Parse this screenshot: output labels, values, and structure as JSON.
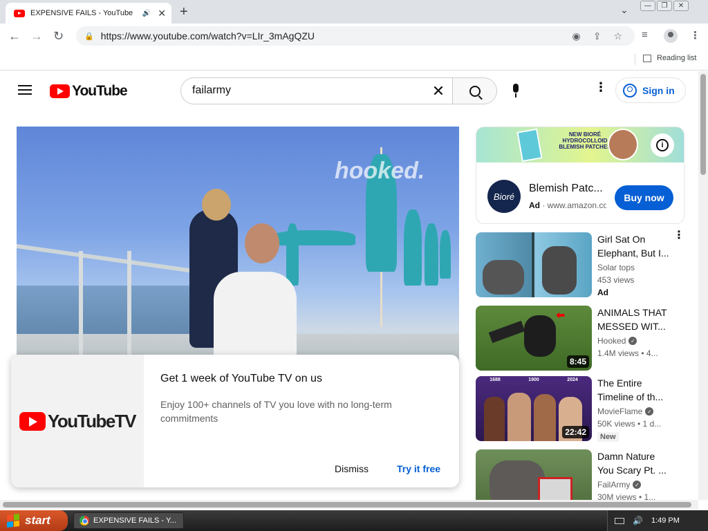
{
  "browser": {
    "tab_title": "EXPENSIVE FAILS - YouTube",
    "tab_speaker": "🔊",
    "tab_close": "✕",
    "new_tab": "+",
    "tab_search": "⌄",
    "win_min": "—",
    "win_restore": "❐",
    "win_close": "✕",
    "back": "←",
    "forward": "→",
    "reload": "↻",
    "lock": "🔒",
    "url": "https://www.youtube.com/watch?v=LIr_3mAgQZU",
    "reading_list": "Reading list"
  },
  "masthead": {
    "logo_text": "YouTube",
    "search_query": "failarmy",
    "clear": "✕",
    "settings": "⋮",
    "signin_label": "Sign in"
  },
  "player": {
    "watermark": "hooked."
  },
  "promo": {
    "logo_text": "YouTubeTV",
    "title": "Get 1 week of YouTube TV on us",
    "description": "Enjoy 100+ channels of TV you love with no long-term commitments",
    "dismiss": "Dismiss",
    "try_free": "Try it free"
  },
  "ad": {
    "banner_text": "NEW BIORÉ HYDROCOLLOID BLEMISH PATCHES",
    "logo_text": "Bioré",
    "title": "Blemish Patc...",
    "ad_label": "Ad",
    "domain": "· www.amazon.co",
    "info": "i",
    "buy_now": "Buy now"
  },
  "recommendations": [
    {
      "title": "Girl Sat On Elephant, But I...",
      "channel": "Solar tops",
      "views": "453 views",
      "badge": "Ad",
      "duration": ""
    },
    {
      "title": "ANIMALS THAT MESSED WIT...",
      "channel": "Hooked",
      "views": "1.4M views  • 4...",
      "badge": "",
      "duration": "8:45"
    },
    {
      "title": "The Entire Timeline of th...",
      "channel": "MovieFlame",
      "views": "50K views  • 1 d...",
      "badge": "New",
      "duration": "22:42"
    },
    {
      "title": "Damn Nature You Scary Pt. ...",
      "channel": "FailArmy",
      "views": "30M views  • 1...",
      "badge": "",
      "duration": ""
    }
  ],
  "rec_kebab": "⋮",
  "verified": "✓",
  "timeline_labels": [
    "1688",
    "1900",
    "2024"
  ],
  "taskbar": {
    "start_label": "start",
    "window_item": "EXPENSIVE FAILS - Y...",
    "clock": "1:49 PM",
    "volume": "🔊"
  },
  "colors": {
    "yt_red": "#ff0000",
    "link_blue": "#065fd4",
    "xp_start": "#d9582a"
  }
}
